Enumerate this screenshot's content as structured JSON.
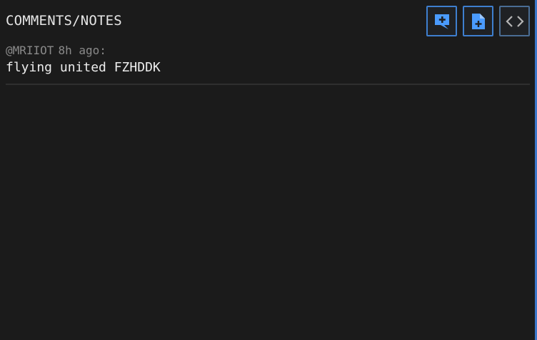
{
  "panel": {
    "title": "COMMENTS/NOTES"
  },
  "toolbar": {
    "buttons": [
      {
        "icon": "add-comment-icon",
        "color": "#4a9bff"
      },
      {
        "icon": "add-note-file-icon",
        "color": "#4a9bff"
      },
      {
        "icon": "code-brackets-icon",
        "color": "#b5b5b5"
      }
    ]
  },
  "comments": [
    {
      "author": "@MRIIOT",
      "time": "8h ago:",
      "text": "flying united FZHDDK"
    }
  ],
  "colors": {
    "background": "#1b1b1b",
    "accent": "#3e7fcf",
    "text": "#ececec",
    "muted": "#8a8a8a"
  }
}
